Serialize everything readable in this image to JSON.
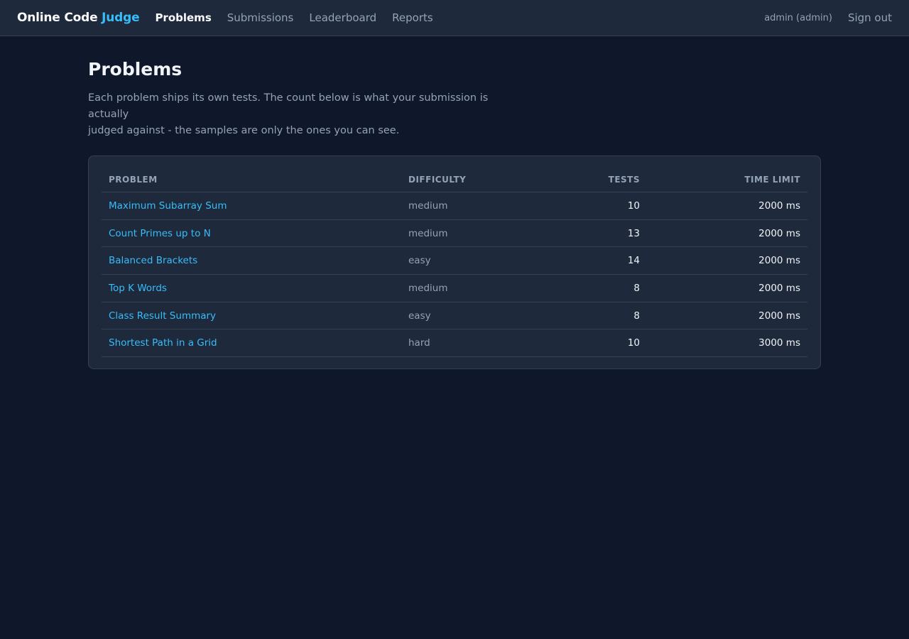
{
  "header": {
    "brand_main": "Online Code ",
    "brand_accent": "Judge",
    "nav": [
      {
        "label": "Problems",
        "active": true
      },
      {
        "label": "Submissions",
        "active": false
      },
      {
        "label": "Leaderboard",
        "active": false
      },
      {
        "label": "Reports",
        "active": false
      }
    ],
    "user": "admin (admin)",
    "signout": "Sign out"
  },
  "page": {
    "title": "Problems",
    "intro_line1": "Each problem ships its own tests. The count below is what your submission is actually",
    "intro_line2": "judged against - the samples are only the ones you can see."
  },
  "table": {
    "headers": {
      "problem": "Problem",
      "difficulty": "Difficulty",
      "tests": "Tests",
      "time_limit": "Time limit"
    },
    "rows": [
      {
        "problem": "Maximum Subarray Sum",
        "difficulty": "medium",
        "tests": "10",
        "time_limit": "2000 ms"
      },
      {
        "problem": "Count Primes up to N",
        "difficulty": "medium",
        "tests": "13",
        "time_limit": "2000 ms"
      },
      {
        "problem": "Balanced Brackets",
        "difficulty": "easy",
        "tests": "14",
        "time_limit": "2000 ms"
      },
      {
        "problem": "Top K Words",
        "difficulty": "medium",
        "tests": "8",
        "time_limit": "2000 ms"
      },
      {
        "problem": "Class Result Summary",
        "difficulty": "easy",
        "tests": "8",
        "time_limit": "2000 ms"
      },
      {
        "problem": "Shortest Path in a Grid",
        "difficulty": "hard",
        "tests": "10",
        "time_limit": "3000 ms"
      }
    ]
  },
  "colors": {
    "background": "#0f172a",
    "surface": "#1e293b",
    "accent": "#38bdf8",
    "muted_text": "#94a3b8"
  }
}
